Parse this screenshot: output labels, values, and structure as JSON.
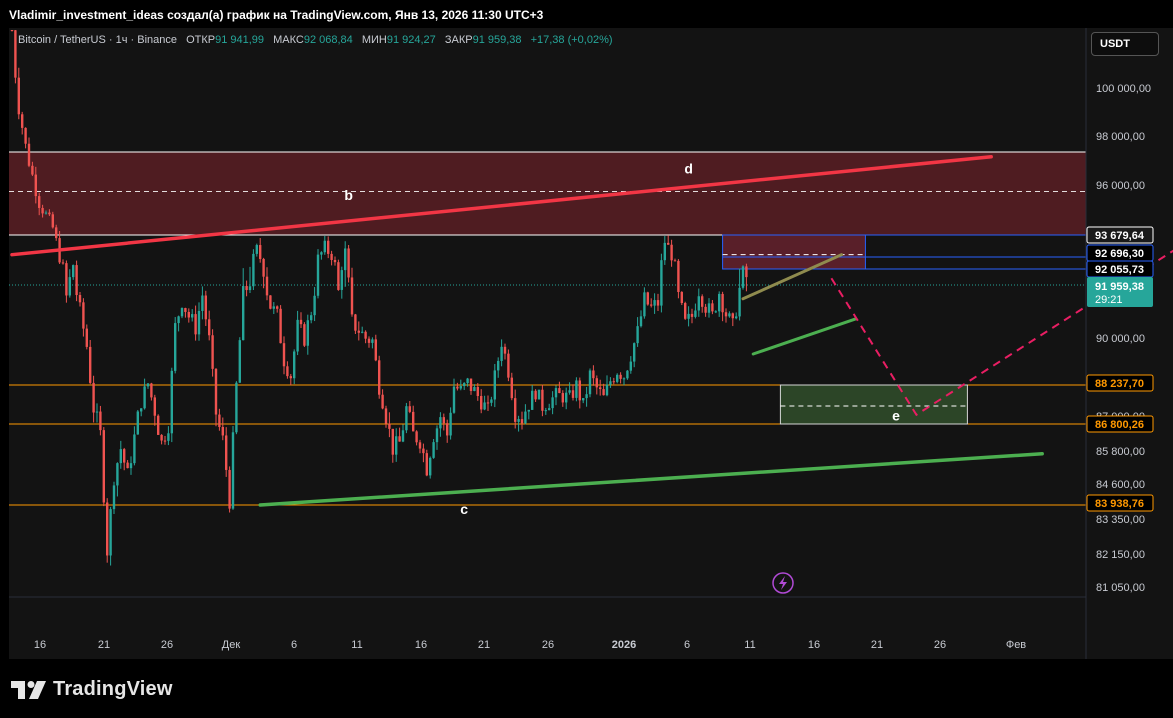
{
  "header": {
    "title": "Vladimir_investment_ideas создал(а) график на TradingView.com, Янв 13, 2026 11:30 UTC+3"
  },
  "legend": {
    "symbol": "Bitcoin / TetherUS · 1ч · Binance",
    "open_label": "ОТКР",
    "open_value": "91 941,99",
    "high_label": "МАКС",
    "high_value": "92 068,84",
    "low_label": "МИН",
    "low_value": "91 924,27",
    "close_label": "ЗАКР",
    "close_value": "91 959,38",
    "change": "+17,38 (+0,02%)"
  },
  "currency_button": "USDT",
  "footer": {
    "brand": "TradingView"
  },
  "colors": {
    "up": "#26a69a",
    "down": "#ef5350",
    "resistance_line": "#f23645",
    "support_line": "#4caf50",
    "zone_red": "#5a1f24",
    "zone_green": "#2c4527",
    "level_orange": "#ff9800",
    "level_blue": "#2962ff",
    "projection": "#e91e63"
  },
  "chart_data": {
    "type": "candlestick",
    "symbol": "BTC/USDT",
    "timeframe": "1h",
    "x_ticks": [
      "16",
      "21",
      "26",
      "Дек",
      "6",
      "11",
      "16",
      "21",
      "26",
      "2026",
      "6",
      "11",
      "16",
      "21",
      "26",
      "Фев"
    ],
    "y_ticks": [
      "100 000,00",
      "98 000,00",
      "96 000,00",
      "90 000,00",
      "87 000,00",
      "85 800,00",
      "84 600,00",
      "83 350,00",
      "82 150,00",
      "81 050,00"
    ],
    "price_labels": [
      {
        "text": "93 679,64",
        "value": 93679.64,
        "color": "#ffffff"
      },
      {
        "text": "92 696,30",
        "value": 92696.3,
        "color": "#2962ff"
      },
      {
        "text": "92 055,73",
        "value": 92055.73,
        "color": "#2962ff"
      },
      {
        "text": "88 237,70",
        "value": 88237.7,
        "color": "#ff9800"
      },
      {
        "text": "86 800,26",
        "value": 86800.26,
        "color": "#ff9800"
      },
      {
        "text": "83 938,76",
        "value": 83938.76,
        "color": "#ff9800"
      }
    ],
    "last_price": {
      "text": "91 959,38",
      "countdown": "29:21",
      "value": 91959.38
    },
    "wave_labels": [
      "b",
      "c",
      "d",
      "e"
    ],
    "price_path": [
      [
        0,
        101800
      ],
      [
        2,
        99200
      ],
      [
        4,
        97600
      ],
      [
        6,
        96400
      ],
      [
        8,
        95200
      ],
      [
        10,
        94600
      ],
      [
        12,
        94000
      ],
      [
        14,
        92700
      ],
      [
        16,
        91500
      ],
      [
        18,
        92300
      ],
      [
        20,
        91000
      ],
      [
        22,
        89700
      ],
      [
        24,
        87300
      ],
      [
        26,
        86400
      ],
      [
        28,
        82300
      ],
      [
        30,
        84900
      ],
      [
        32,
        85900
      ],
      [
        34,
        84900
      ],
      [
        36,
        86300
      ],
      [
        38,
        87600
      ],
      [
        40,
        88300
      ],
      [
        42,
        87200
      ],
      [
        44,
        86100
      ],
      [
        46,
        86800
      ],
      [
        48,
        90400
      ],
      [
        50,
        91400
      ],
      [
        52,
        90800
      ],
      [
        54,
        90400
      ],
      [
        56,
        91600
      ],
      [
        58,
        89900
      ],
      [
        60,
        87100
      ],
      [
        62,
        86200
      ],
      [
        64,
        84100
      ],
      [
        66,
        88200
      ],
      [
        68,
        91600
      ],
      [
        70,
        92100
      ],
      [
        72,
        93000
      ],
      [
        74,
        92300
      ],
      [
        76,
        91200
      ],
      [
        78,
        90800
      ],
      [
        80,
        89200
      ],
      [
        82,
        88600
      ],
      [
        84,
        90400
      ],
      [
        86,
        90000
      ],
      [
        88,
        91000
      ],
      [
        90,
        92600
      ],
      [
        92,
        93100
      ],
      [
        94,
        92800
      ],
      [
        96,
        91700
      ],
      [
        98,
        92900
      ],
      [
        100,
        90600
      ],
      [
        102,
        90300
      ],
      [
        104,
        90000
      ],
      [
        106,
        89900
      ],
      [
        108,
        88200
      ],
      [
        110,
        87100
      ],
      [
        112,
        85900
      ],
      [
        114,
        86100
      ],
      [
        116,
        87300
      ],
      [
        118,
        86400
      ],
      [
        120,
        86200
      ],
      [
        122,
        85200
      ],
      [
        124,
        86400
      ],
      [
        126,
        87000
      ],
      [
        128,
        86400
      ],
      [
        130,
        88200
      ],
      [
        132,
        88000
      ],
      [
        134,
        88300
      ],
      [
        136,
        88000
      ],
      [
        138,
        87600
      ],
      [
        140,
        87200
      ],
      [
        142,
        88500
      ],
      [
        144,
        89900
      ],
      [
        146,
        88800
      ],
      [
        148,
        87200
      ],
      [
        150,
        87000
      ],
      [
        152,
        87500
      ],
      [
        154,
        88000
      ],
      [
        156,
        87400
      ],
      [
        158,
        87600
      ],
      [
        160,
        87800
      ],
      [
        162,
        87800
      ],
      [
        164,
        87700
      ],
      [
        166,
        88200
      ],
      [
        168,
        87400
      ],
      [
        170,
        88600
      ],
      [
        172,
        88100
      ],
      [
        174,
        87700
      ],
      [
        176,
        88400
      ],
      [
        178,
        88800
      ],
      [
        180,
        88600
      ],
      [
        182,
        89400
      ],
      [
        184,
        90200
      ],
      [
        186,
        91400
      ],
      [
        188,
        91100
      ],
      [
        190,
        91300
      ],
      [
        192,
        93400
      ],
      [
        194,
        92800
      ],
      [
        196,
        91500
      ],
      [
        198,
        90500
      ],
      [
        200,
        90800
      ],
      [
        202,
        91800
      ],
      [
        204,
        91200
      ],
      [
        206,
        90800
      ],
      [
        208,
        91700
      ],
      [
        210,
        90900
      ],
      [
        212,
        90400
      ],
      [
        214,
        91800
      ],
      [
        216,
        92000
      ]
    ],
    "annotations": {
      "resistance_zone": [
        93679.64,
        97400
      ],
      "resistance_zone_mid": 95700,
      "small_resistance_box": [
        92055.73,
        93679.64
      ],
      "small_box_mid": 92800,
      "support_zone": [
        86800.26,
        88237.7
      ],
      "support_zone_mid": 87400,
      "resistance_trendline": [
        [
          0,
          92800
        ],
        [
          288,
          97200
        ]
      ],
      "support_trendline": [
        [
          73,
          83938.76
        ],
        [
          303,
          85700
        ]
      ],
      "wedge_upper": [
        [
          215,
          91450
        ],
        [
          244,
          92800
        ]
      ],
      "wedge_lower": [
        [
          218,
          89400
        ],
        [
          248,
          90700
        ]
      ],
      "projection": [
        [
          241,
          92000
        ],
        [
          266,
          87050
        ],
        [
          349,
          93700
        ]
      ]
    }
  }
}
